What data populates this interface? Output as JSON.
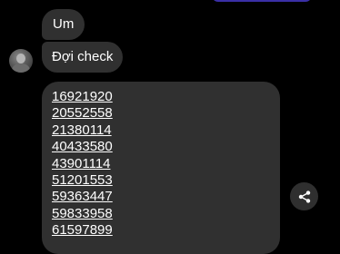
{
  "messages": {
    "first_text": "Um",
    "second_text": "Đợi check",
    "numbers": [
      "16921920",
      "20552558",
      "21380114",
      "40433580",
      "43901114",
      "51201553",
      "59363447",
      "59833958",
      "61597899"
    ]
  },
  "icons": {
    "avatar": "avatar",
    "share": "share-icon"
  },
  "colors": {
    "background": "#000000",
    "bubble": "#303030",
    "sent_bubble_accent": "#3a2fa6",
    "text": "#ffffff"
  }
}
